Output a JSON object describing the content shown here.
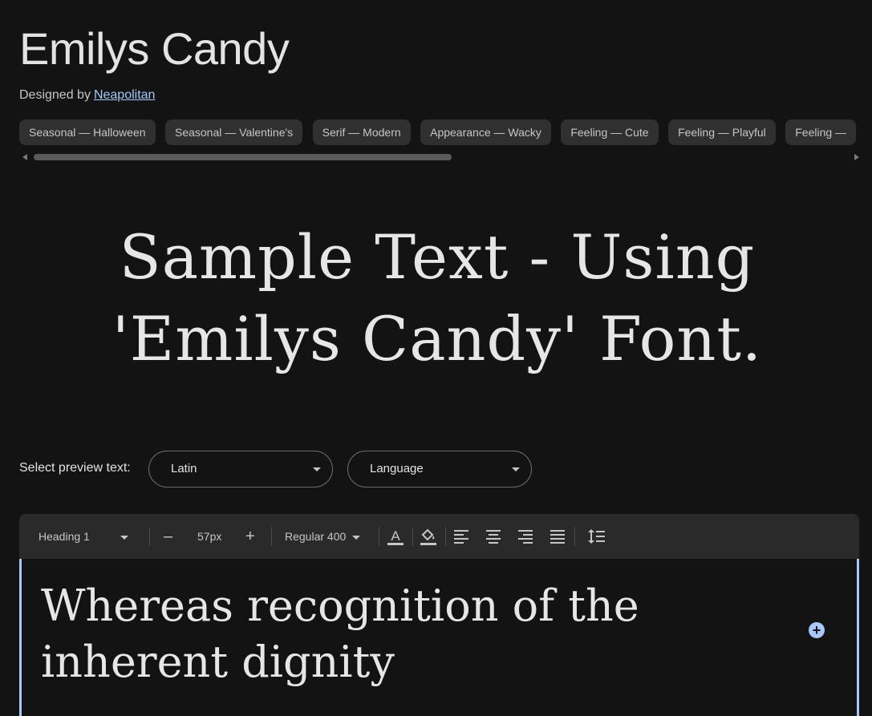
{
  "font": {
    "name": "Emilys Candy",
    "designed_by_label": "Designed by",
    "designer": "Neapolitan"
  },
  "tags": [
    "Seasonal — Halloween",
    "Seasonal — Valentine's",
    "Serif — Modern",
    "Appearance — Wacky",
    "Feeling — Cute",
    "Feeling — Playful",
    "Feeling —"
  ],
  "sample_text": "Sample Text - Using 'Emilys Candy' Font.",
  "preview": {
    "label": "Select preview text:",
    "script_select": "Latin",
    "language_select": "Language"
  },
  "toolbar": {
    "style_select": "Heading 1",
    "size_decrease": "–",
    "size_value": "57px",
    "size_increase": "+",
    "weight_select": "Regular 400"
  },
  "editor": {
    "text": "Whereas recognition of the inherent dignity",
    "add_button": "+"
  },
  "colors": {
    "background": "#131313",
    "chip_bg": "#303030",
    "link": "#a8c7fa",
    "accent": "#a8c7fa"
  }
}
